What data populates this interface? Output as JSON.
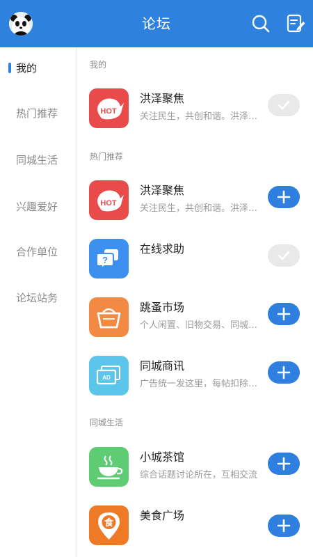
{
  "header": {
    "title": "论坛",
    "avatar_icon": "panda-avatar",
    "search_icon": "search-icon",
    "post_icon": "edit-note-icon",
    "bg_color": "#2e82dd"
  },
  "sidebar": {
    "items": [
      {
        "label": "我的",
        "active": true
      },
      {
        "label": "热门推荐",
        "active": false
      },
      {
        "label": "同城生活",
        "active": false
      },
      {
        "label": "兴趣爱好",
        "active": false
      },
      {
        "label": "合作单位",
        "active": false
      },
      {
        "label": "论坛站务",
        "active": false
      }
    ]
  },
  "sections": {
    "mine": "我的",
    "hot": "热门推荐",
    "city": "同城生活"
  },
  "boards": [
    {
      "title": "洪泽聚焦",
      "desc": "关注民生，共创和谐。洪泽聚焦论坛欢迎您",
      "icon": "hot-badge-icon",
      "icon_color": "#e94b4b",
      "state": "joined"
    },
    {
      "title": "洪泽聚焦",
      "desc": "关注民生，共创和谐。洪泽聚焦论坛欢迎您",
      "icon": "hot-badge-icon",
      "icon_color": "#e94b4b",
      "state": "add"
    },
    {
      "title": "在线求助",
      "desc": "",
      "icon": "question-chat-icon",
      "icon_color": "#3d8ff0",
      "state": "joined"
    },
    {
      "title": "跳蚤市场",
      "desc": "个人闲置、旧物交易、同城转让",
      "icon": "basket-icon",
      "icon_color": "#f28a44",
      "state": "add"
    },
    {
      "title": "同城商讯",
      "desc": "广告统一发这里，每帖扣除积分",
      "icon": "ad-card-icon",
      "icon_color": "#5cc6ea",
      "state": "add"
    },
    {
      "title": "小城茶馆",
      "desc": "综合话题讨论所在，互相交流",
      "icon": "tea-cup-icon",
      "icon_color": "#5ecc72",
      "state": "add"
    },
    {
      "title": "美食广场",
      "desc": "",
      "icon": "food-pin-icon",
      "icon_color": "#ef7a26",
      "state": "add"
    }
  ],
  "colors": {
    "accent": "#2e7fe0",
    "joined_bg": "#e9e9e9"
  }
}
